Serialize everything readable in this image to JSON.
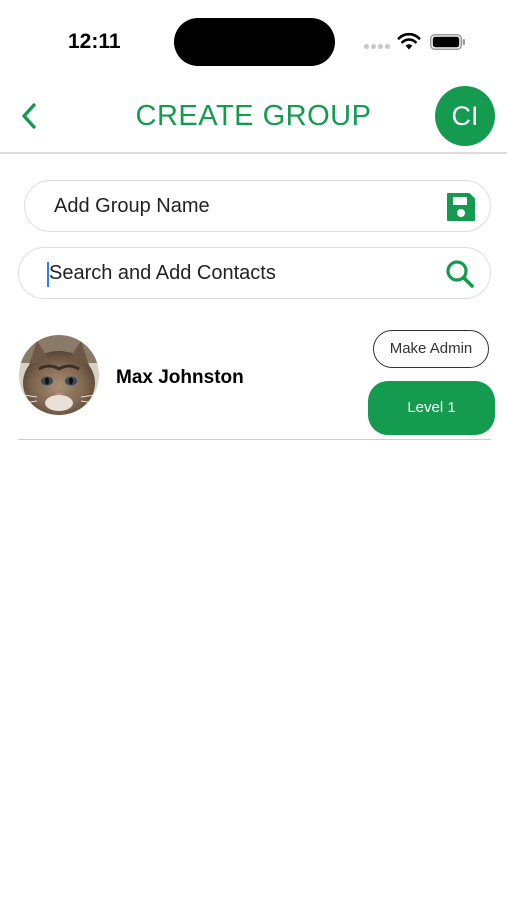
{
  "status_bar": {
    "time": "12:11"
  },
  "header": {
    "title": "CREATE GROUP",
    "avatar_initials": "CI",
    "back_icon": "chevron-left-icon"
  },
  "group_name_field": {
    "text": "Add Group Name",
    "icon": "save-icon"
  },
  "search_field": {
    "text": "Search and Add Contacts",
    "icon": "search-icon"
  },
  "contacts": [
    {
      "name": "Max Johnston",
      "make_admin_label": "Make Admin",
      "level_label": "Level 1"
    }
  ],
  "colors": {
    "accent": "#149b4f",
    "divider": "#dcdcdc",
    "field_border": "#dddddd"
  }
}
